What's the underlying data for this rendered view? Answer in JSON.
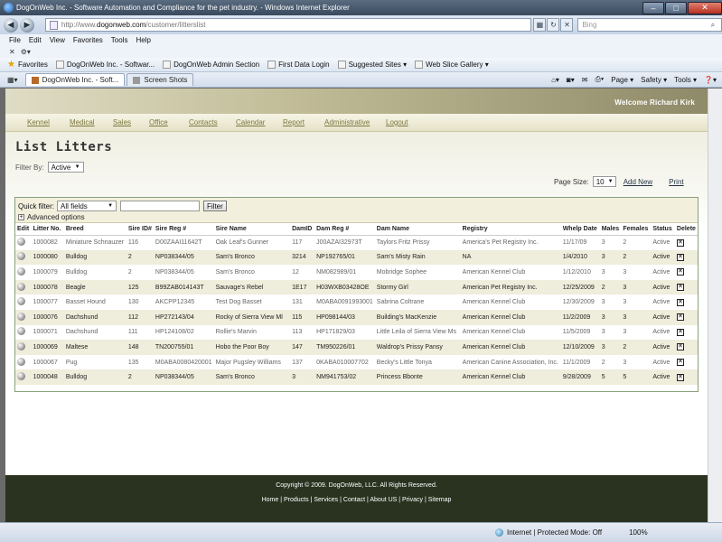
{
  "window": {
    "title": "DogOnWeb Inc. - Software Automation and Compliance for the pet industry. - Windows Internet Explorer",
    "min": "–",
    "max": "□",
    "close": "✕"
  },
  "address": {
    "url_prefix": "http://www.",
    "url_domain": "dogonweb.com",
    "url_path": "/customer/litterslist",
    "search_placeholder": "Bing"
  },
  "menu": [
    "File",
    "Edit",
    "View",
    "Favorites",
    "Tools",
    "Help"
  ],
  "favorites": {
    "label": "Favorites",
    "items": [
      "DogOnWeb Inc. - Softwar...",
      "DogOnWeb Admin Section",
      "First Data Login",
      "Suggested Sites ▾",
      "Web Slice Gallery ▾"
    ]
  },
  "tabs": {
    "items": [
      "DogOnWeb Inc. - Soft...",
      "Screen Shots"
    ],
    "tools": [
      "Page ▾",
      "Safety ▾",
      "Tools ▾",
      "❓▾"
    ]
  },
  "site": {
    "welcome": "Welcome Richard Kirk",
    "nav": [
      "Kennel",
      "Medical",
      "Sales",
      "Office",
      "Contacts",
      "Calendar",
      "Report",
      "Administrative",
      "Logout"
    ],
    "title": "List Litters",
    "filter_label": "Filter By:",
    "filter_value": "Active",
    "page_size_label": "Page Size:",
    "page_size_value": "10",
    "add_new": "Add New",
    "print": "Print"
  },
  "grid": {
    "quick_filter_label": "Quick filter:",
    "quick_filter_field": "All fields",
    "filter_button": "Filter",
    "advanced": "Advanced options",
    "columns": [
      "Edit",
      "Litter No.",
      "Breed",
      "Sire ID#",
      "Sire Reg #",
      "Sire Name",
      "DamID",
      "Dam Reg #",
      "Dam Name",
      "Registry",
      "Whelp Date",
      "Males",
      "Females",
      "Status",
      "Delete"
    ],
    "rows": [
      [
        "1000082",
        "Miniature Schnauzer",
        "116",
        "D00ZAAI11642T",
        "Oak Leaf's Gunner",
        "117",
        "J00AZAI32973T",
        "Taylors Fritz Prissy",
        "America's Pet Registry Inc.",
        "11/17/09",
        "3",
        "2",
        "Active"
      ],
      [
        "1000080",
        "Bulldog",
        "2",
        "NP038344/05",
        "Sam's Bronco",
        "3214",
        "NP192765/01",
        "Sam's Misty Rain",
        "NA",
        "1/4/2010",
        "3",
        "2",
        "Active"
      ],
      [
        "1000079",
        "Bulldog",
        "2",
        "NP038344/05",
        "Sam's Bronco",
        "12",
        "NM082989/01",
        "Mobridge Sophee",
        "American Kennel Club",
        "1/12/2010",
        "3",
        "3",
        "Active"
      ],
      [
        "1000078",
        "Beagle",
        "125",
        "B99ZAB014143T",
        "Sauvage's Rebel",
        "1E17",
        "H03WXB03428OE",
        "Stormy Girl",
        "American Pet Registry Inc.",
        "12/25/2009",
        "2",
        "3",
        "Active"
      ],
      [
        "1000077",
        "Basset Hound",
        "130",
        "AKCPP12345",
        "Test Dog Basset",
        "131",
        "M0ABA0091993001",
        "Sabrina Coltrane",
        "American Kennel Club",
        "12/30/2009",
        "3",
        "3",
        "Active"
      ],
      [
        "1000076",
        "Dachshund",
        "112",
        "HP272143/04",
        "Rocky of Sierra View Ml",
        "115",
        "HP098144/03",
        "Building's MacKenzie",
        "American Kennel Club",
        "11/2/2009",
        "3",
        "3",
        "Active"
      ],
      [
        "1000071",
        "Dachshund",
        "111",
        "HP124108/02",
        "Rollie's Marvin",
        "113",
        "HP171829/03",
        "Little Leila of Sierra View Ms",
        "American Kennel Club",
        "11/5/2009",
        "3",
        "3",
        "Active"
      ],
      [
        "1000069",
        "Maltese",
        "148",
        "TN200755/01",
        "Hobo the Poor Boy",
        "147",
        "TM950226/01",
        "Waldrop's Prissy Pansy",
        "American Kennel Club",
        "12/10/2009",
        "3",
        "2",
        "Active"
      ],
      [
        "1000067",
        "Pug",
        "135",
        "M0ABA0080420001",
        "Major Pugsley Williams",
        "137",
        "0KABA010007702",
        "Becky's Little Tonya",
        "American Canine Association, Inc.",
        "11/1/2009",
        "2",
        "3",
        "Active"
      ],
      [
        "1000048",
        "Bulldog",
        "2",
        "NP038344/05",
        "Sam's Bronco",
        "3",
        "NM941753/02",
        "Princess Bbonte",
        "American Kennel Club",
        "9/28/2009",
        "5",
        "5",
        "Active"
      ]
    ]
  },
  "footer": {
    "copyright": "Copyright © 2009.  DogOnWeb, LLC.  All Rights Reserved.",
    "links": [
      "Home",
      "Products",
      "Services",
      "Contact",
      "About US",
      "Privacy",
      "Sitemap"
    ]
  },
  "status": {
    "zone": "Internet | Protected Mode: Off",
    "zoom": "100%"
  }
}
